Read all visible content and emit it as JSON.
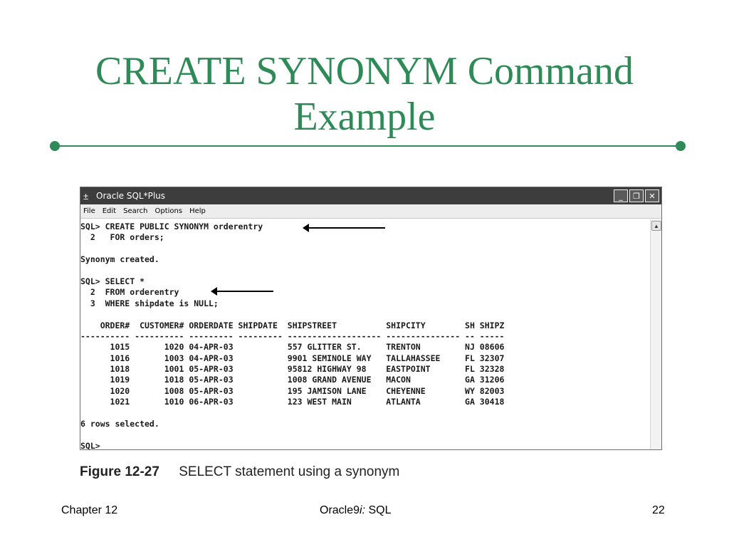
{
  "slide": {
    "title_line1": "CREATE SYNONYM Command",
    "title_line2": "Example",
    "accent_color": "#2e8b57"
  },
  "window": {
    "icon": "sqlplus-app-icon",
    "title": "Oracle SQL*Plus",
    "controls": {
      "minimize": "_",
      "restore": "❐",
      "close": "✕"
    },
    "menu": [
      "File",
      "Edit",
      "Search",
      "Options",
      "Help"
    ]
  },
  "console": {
    "lines": [
      "SQL> CREATE PUBLIC SYNONYM orderentry",
      "  2   FOR orders;",
      "",
      "Synonym created.",
      "",
      "SQL> SELECT *",
      "  2  FROM orderentry",
      "  3  WHERE shipdate is NULL;",
      "",
      "    ORDER#  CUSTOMER# ORDERDATE SHIPDATE  SHIPSTREET          SHIPCITY        SH SHIPZ",
      "---------- ---------- --------- --------- ------------------- --------------- -- -----",
      "      1015       1020 04-APR-03           557 GLITTER ST.     TRENTON         NJ 08606",
      "      1016       1003 04-APR-03           9901 SEMINOLE WAY   TALLAHASSEE     FL 32307",
      "      1018       1001 05-APR-03           95812 HIGHWAY 98    EASTPOINT       FL 32328",
      "      1019       1018 05-APR-03           1008 GRAND AVENUE   MACON           GA 31206",
      "      1020       1008 05-APR-03           195 JAMISON LANE    CHEYENNE        WY 82003",
      "      1021       1010 06-APR-03           123 WEST MAIN       ATLANTA         GA 30418",
      "",
      "6 rows selected.",
      "",
      "SQL>"
    ]
  },
  "caption": {
    "figure": "Figure 12-27",
    "text": "SELECT statement using a synonym"
  },
  "footer": {
    "left": "Chapter 12",
    "center_prefix": "Oracle9",
    "center_italic": "i:",
    "center_suffix": " SQL",
    "page": "22"
  }
}
